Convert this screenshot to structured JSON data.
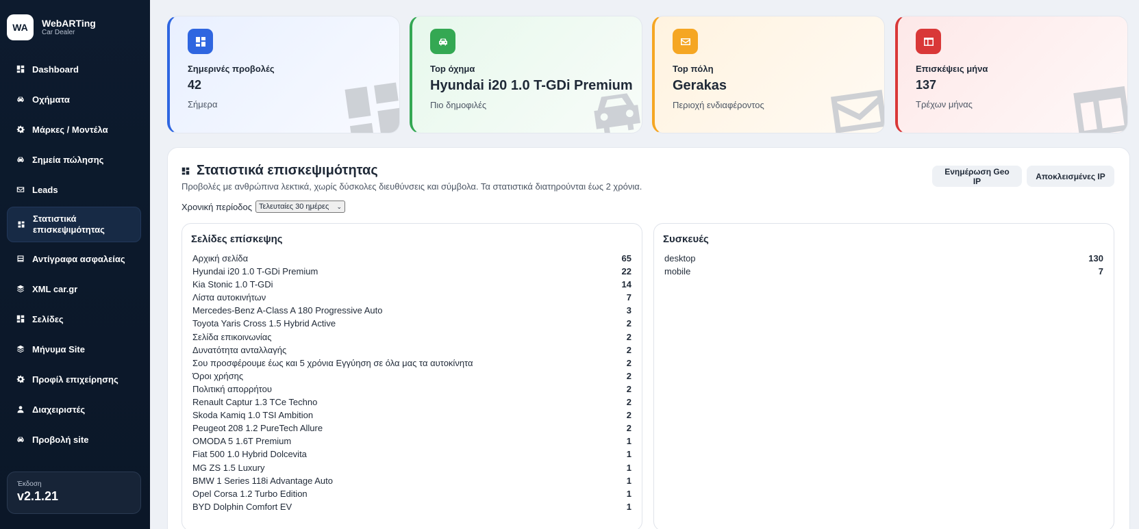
{
  "brand": {
    "logo": "WA",
    "name": "WebARTing",
    "subtitle": "Car Dealer"
  },
  "sidebar": {
    "items": [
      {
        "label": "Dashboard",
        "icon": "grid-icon"
      },
      {
        "label": "Οχήματα",
        "icon": "car-icon"
      },
      {
        "label": "Μάρκες / Μοντέλα",
        "icon": "gear-icon"
      },
      {
        "label": "Σημεία πώλησης",
        "icon": "car-icon"
      },
      {
        "label": "Leads",
        "icon": "mail-icon"
      },
      {
        "label": "Στατιστικά επισκεψιμότητας",
        "icon": "grid-small-icon",
        "active": true
      },
      {
        "label": "Αντίγραφα ασφαλείας",
        "icon": "database-icon"
      },
      {
        "label": "XML car.gr",
        "icon": "layers-icon"
      },
      {
        "label": "Σελίδες",
        "icon": "grid-icon"
      },
      {
        "label": "Μήνυμα Site",
        "icon": "layers-icon"
      },
      {
        "label": "Προφίλ επιχείρησης",
        "icon": "gear-icon"
      },
      {
        "label": "Διαχειριστές",
        "icon": "user-icon"
      },
      {
        "label": "Προβολή site",
        "icon": "car-icon"
      }
    ],
    "version_label": "Έκδοση",
    "version_value": "v2.1.21"
  },
  "cards": {
    "views": {
      "label": "Σημερινές προβολές",
      "value": "42",
      "sub": "Σήμερα",
      "color": "#2f66e0"
    },
    "vehicle": {
      "label": "Top όχημα",
      "value": "Hyundai i20 1.0 T-GDi Premium",
      "sub": "Πιο δημοφιλές",
      "color": "#34a853"
    },
    "city": {
      "label": "Top πόλη",
      "value": "Gerakas",
      "sub": "Περιοχή ενδιαφέροντος",
      "color": "#f5a623"
    },
    "visits": {
      "label": "Επισκέψεις μήνα",
      "value": "137",
      "sub": "Τρέχων μήνας",
      "color": "#d93838"
    }
  },
  "stats": {
    "title": "Στατιστικά επισκεψιμότητας",
    "description": "Προβολές με ανθρώπινα λεκτικά, χωρίς δύσκολες διευθύνσεις και σύμβολα. Τα στατιστικά διατηρούνται έως 2 χρόνια.",
    "geo_button": "Ενημέρωση Geo IP",
    "blocked_button": "Αποκλεισμένες IP",
    "period_label": "Χρονική περίοδος",
    "period_value": "Τελευταίες 30 ημέρες",
    "pages_title": "Σελίδες επίσκεψης",
    "pages": [
      {
        "name": "Αρχική σελίδα",
        "count": "65"
      },
      {
        "name": "Hyundai i20 1.0 T-GDi Premium",
        "count": "22"
      },
      {
        "name": "Kia Stonic 1.0 T-GDi",
        "count": "14"
      },
      {
        "name": "Λίστα αυτοκινήτων",
        "count": "7"
      },
      {
        "name": "Mercedes-Benz A-Class A 180 Progressive Auto",
        "count": "3"
      },
      {
        "name": "Toyota Yaris Cross 1.5 Hybrid Active",
        "count": "2"
      },
      {
        "name": "Σελίδα επικοινωνίας",
        "count": "2"
      },
      {
        "name": "Δυνατότητα ανταλλαγής",
        "count": "2"
      },
      {
        "name": "Σου προσφέρουμε έως και 5 χρόνια Εγγύηση σε όλα μας τα αυτοκίνητα",
        "count": "2"
      },
      {
        "name": "Όροι χρήσης",
        "count": "2"
      },
      {
        "name": "Πολιτική απορρήτου",
        "count": "2"
      },
      {
        "name": "Renault Captur 1.3 TCe Techno",
        "count": "2"
      },
      {
        "name": "Skoda Kamiq 1.0 TSI Ambition",
        "count": "2"
      },
      {
        "name": "Peugeot 208 1.2 PureTech Allure",
        "count": "2"
      },
      {
        "name": "OMODA 5 1.6T Premium",
        "count": "1"
      },
      {
        "name": "Fiat 500 1.0 Hybrid Dolcevita",
        "count": "1"
      },
      {
        "name": "MG ZS 1.5 Luxury",
        "count": "1"
      },
      {
        "name": "BMW 1 Series 118i Advantage Auto",
        "count": "1"
      },
      {
        "name": "Opel Corsa 1.2 Turbo Edition",
        "count": "1"
      },
      {
        "name": "BYD Dolphin Comfort EV",
        "count": "1"
      }
    ],
    "devices_title": "Συσκευές",
    "devices": [
      {
        "name": "desktop",
        "count": "130"
      },
      {
        "name": "mobile",
        "count": "7"
      }
    ]
  }
}
